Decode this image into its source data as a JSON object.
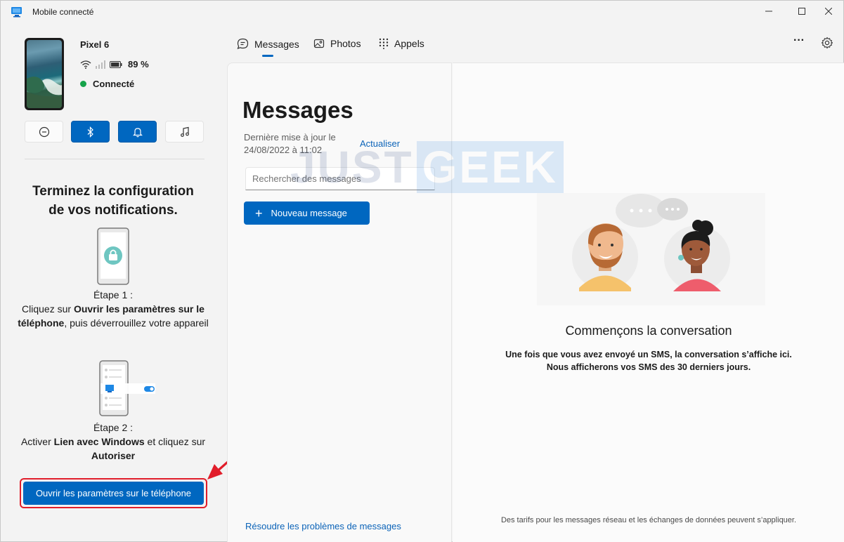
{
  "window": {
    "title": "Mobile connecté",
    "icon": "phone-link-icon"
  },
  "device": {
    "name": "Pixel 6",
    "battery": "89 %",
    "status": "Connecté",
    "status_color": "#16a34a"
  },
  "quick_actions": [
    {
      "name": "do-not-disturb",
      "icon": "minus-circle-icon",
      "active": false
    },
    {
      "name": "bluetooth",
      "icon": "bluetooth-icon",
      "active": true
    },
    {
      "name": "notifications",
      "icon": "bell-icon",
      "active": true
    },
    {
      "name": "media",
      "icon": "music-icon",
      "active": false
    }
  ],
  "setup": {
    "title_line1": "Terminez la configuration",
    "title_line2": "de vos notifications.",
    "step1_label": "Étape 1 :",
    "step1_prefix": "Cliquez sur ",
    "step1_bold": "Ouvrir les paramètres sur le téléphone",
    "step1_suffix": ", puis déverrouillez votre appareil",
    "step2_label": "Étape 2 :",
    "step2_prefix": "Activer ",
    "step2_bold1": "Lien avec Windows",
    "step2_mid": " et cliquez sur ",
    "step2_bold2": "Autoriser",
    "open_settings_button": "Ouvrir les paramètres sur le téléphone"
  },
  "nav": {
    "tabs": [
      {
        "label": "Messages",
        "icon": "chat-icon",
        "active": true
      },
      {
        "label": "Photos",
        "icon": "photo-icon",
        "active": false
      },
      {
        "label": "Appels",
        "icon": "dialpad-icon",
        "active": false
      }
    ],
    "more": "···",
    "settings_icon": "gear-icon"
  },
  "messages": {
    "title": "Messages",
    "last_update_line1": "Dernière mise à jour le",
    "last_update_line2": "24/08/2022 à 11:02",
    "refresh": "Actualiser",
    "search_placeholder": "Rechercher des messages",
    "new_message": "Nouveau message",
    "troubleshoot": "Résoudre les problèmes de messages"
  },
  "conversation": {
    "title": "Commençons la conversation",
    "line1": "Une fois que vous avez envoyé un SMS, la conversation s’affiche ici.",
    "line2": "Nous afficherons vos SMS des 30 derniers jours.",
    "footer": "Des tarifs pour les messages réseau et les échanges de données peuvent s’appliquer."
  },
  "watermark": {
    "part1": "JUST",
    "part2": "GEEK"
  },
  "colors": {
    "accent": "#0067c0",
    "link": "#0b63b8",
    "highlight": "#e11d2a"
  }
}
